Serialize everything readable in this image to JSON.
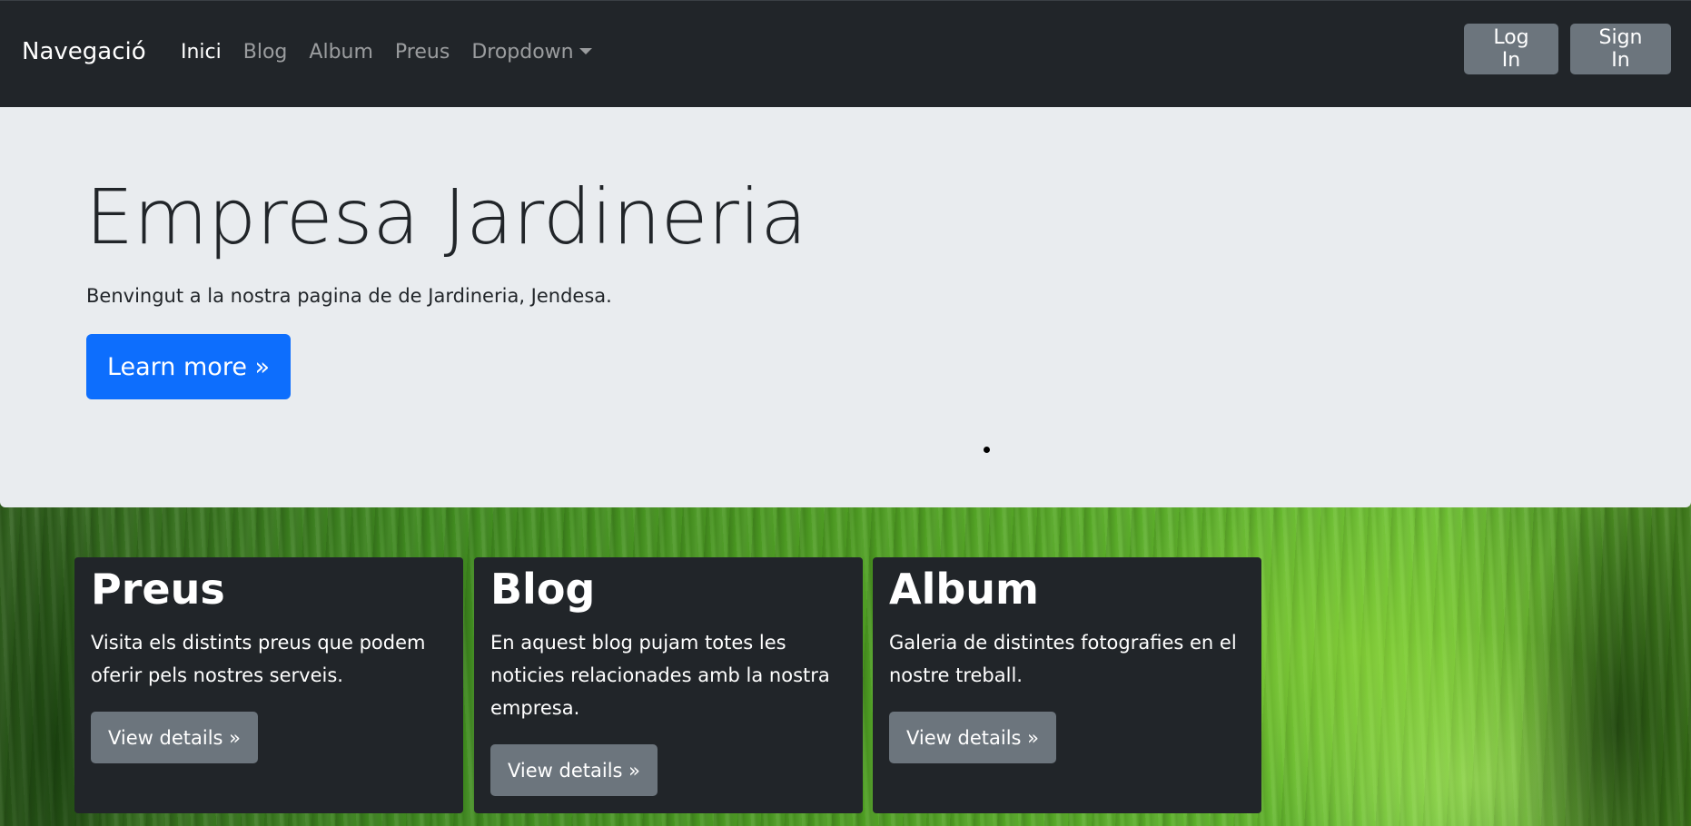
{
  "navbar": {
    "brand": "Navegació",
    "links": [
      {
        "label": "Inici",
        "active": true
      },
      {
        "label": "Blog",
        "active": false
      },
      {
        "label": "Album",
        "active": false
      },
      {
        "label": "Preus",
        "active": false
      },
      {
        "label": "Dropdown",
        "active": false
      }
    ],
    "login_label": "Log In",
    "signin_label": "Sign In"
  },
  "jumbotron": {
    "title": "Empresa Jardineria",
    "lead": "Benvingut a la nostra pagina de de Jardineria, Jendesa.",
    "button_label": "Learn more »"
  },
  "cards": [
    {
      "title": "Preus",
      "text": "Visita els distints preus que podem oferir pels nostres serveis.",
      "button_label": "View details »"
    },
    {
      "title": "Blog",
      "text": "En aquest blog pujam totes les noticies relacionades amb la nostra empresa.",
      "button_label": "View details »"
    },
    {
      "title": "Album",
      "text": "Galeria de distintes fotografies en el nostre treball.",
      "button_label": "View details »"
    }
  ],
  "colors": {
    "navbar_bg": "#212529",
    "jumbotron_bg": "#e9ecef",
    "primary": "#0d6efd",
    "secondary": "#6c757d",
    "card_bg": "#212529"
  },
  "icons": {
    "dropdown": "caret-down-icon"
  }
}
